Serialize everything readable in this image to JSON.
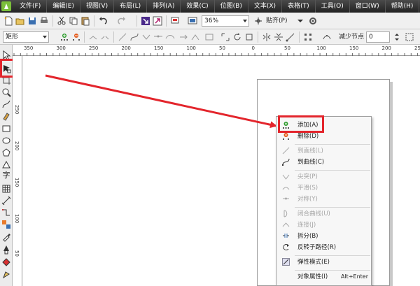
{
  "menubar": {
    "items": [
      "文件(F)",
      "编辑(E)",
      "视图(V)",
      "布局(L)",
      "排列(A)",
      "效果(C)",
      "位图(B)",
      "文本(X)",
      "表格(T)",
      "工具(O)",
      "窗口(W)",
      "帮助(H)"
    ]
  },
  "toolbar": {
    "zoom": "36%",
    "snap_label": "贴齐(P)",
    "object_type": "矩形",
    "reduce_nodes_label": "减少节点",
    "reduce_nodes_value": "0"
  },
  "ruler": {
    "h_labels": [
      "350",
      "300",
      "250",
      "200",
      "150",
      "100",
      "50",
      "0",
      "50",
      "100",
      "150",
      "200",
      "250"
    ],
    "v_labels": [
      "250",
      "200",
      "150",
      "100",
      "50"
    ]
  },
  "context_menu": {
    "items": [
      {
        "label": "添加(A)",
        "enabled": true,
        "icon": "add-node-icon"
      },
      {
        "label": "删除(D)",
        "enabled": true,
        "icon": "delete-node-icon"
      },
      {
        "label": "到直线(L)",
        "enabled": false,
        "icon": "to-line-icon"
      },
      {
        "label": "到曲线(C)",
        "enabled": true,
        "icon": "to-curve-icon"
      },
      {
        "label": "尖突(P)",
        "enabled": false,
        "icon": "cusp-icon"
      },
      {
        "label": "平滑(S)",
        "enabled": false,
        "icon": "smooth-icon"
      },
      {
        "label": "对称(Y)",
        "enabled": false,
        "icon": "symmetric-icon"
      },
      {
        "label": "闭合曲线(U)",
        "enabled": false,
        "icon": "close-curve-icon"
      },
      {
        "label": "连接(J)",
        "enabled": false,
        "icon": "join-icon"
      },
      {
        "label": "拆分(B)",
        "enabled": true,
        "icon": "break-apart-icon"
      },
      {
        "label": "反转子路径(R)",
        "enabled": true,
        "icon": "reverse-subpath-icon"
      },
      {
        "label": "弹性模式(E)",
        "enabled": true,
        "icon": "elastic-mode-icon"
      },
      {
        "label": "对象属性(I)",
        "enabled": true,
        "icon": "",
        "shortcut": "Alt+Enter"
      }
    ]
  },
  "colors": {
    "highlight": "#e3252c",
    "menubar": "#2d2d2d",
    "disabled_text": "#a5a5a5"
  }
}
